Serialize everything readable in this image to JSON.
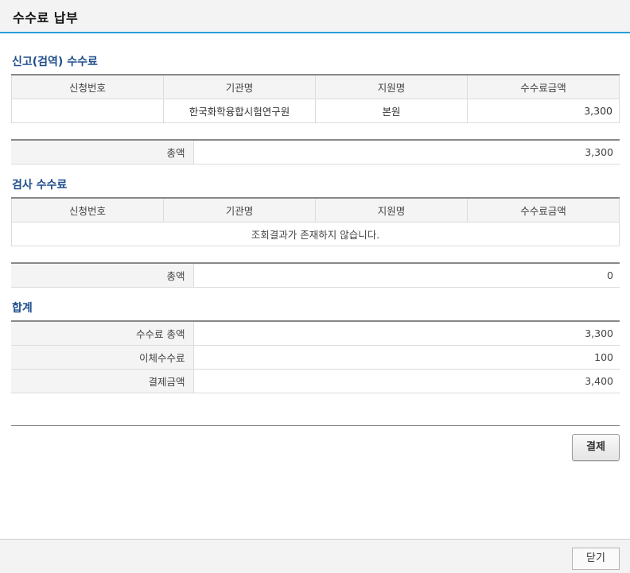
{
  "title": "수수료 납부",
  "sections": {
    "report": {
      "title": "신고(검역) 수수료",
      "columns": [
        "신청번호",
        "기관명",
        "지원명",
        "수수료금액"
      ],
      "rows": [
        {
          "app_no": "",
          "agency": "한국화학융합시험연구원",
          "branch": "본원",
          "amount": "3,300"
        }
      ],
      "total_label": "총액",
      "total_value": "3,300"
    },
    "inspection": {
      "title": "검사 수수료",
      "columns": [
        "신청번호",
        "기관명",
        "지원명",
        "수수료금액"
      ],
      "empty_message": "조회결과가 존재하지 않습니다.",
      "total_label": "총액",
      "total_value": "0"
    },
    "summary": {
      "title": "합계",
      "rows": [
        {
          "label": "수수료 총액",
          "value": "3,300"
        },
        {
          "label": "이체수수료",
          "value": "100"
        },
        {
          "label": "결제금액",
          "value": "3,400"
        }
      ]
    }
  },
  "buttons": {
    "pay": "결제",
    "close": "닫기"
  },
  "colors": {
    "accent": "#2a9fd8",
    "section_title": "#1f4e8c"
  }
}
